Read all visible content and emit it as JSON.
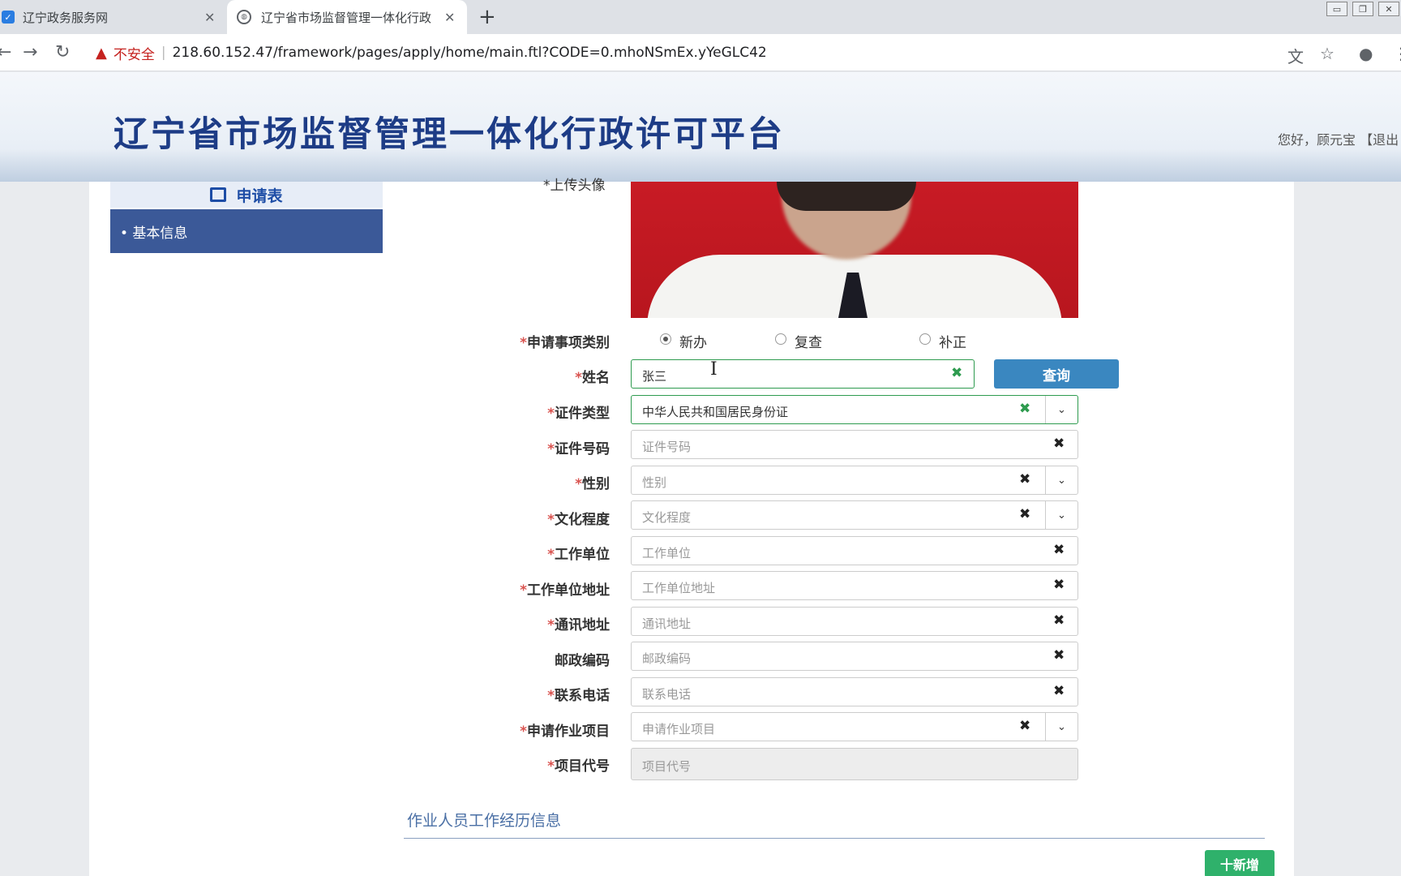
{
  "browser": {
    "tabs": [
      {
        "title": "辽宁政务服务网"
      },
      {
        "title": "辽宁省市场监督管理一体化行政许"
      }
    ],
    "new_tab": "+",
    "security_label": "不安全",
    "url": "218.60.152.47/framework/pages/apply/home/main.ftl?CODE=0.mhoNSmEx.yYeGLC42",
    "icons": [
      "back-arrow-icon",
      "forward-arrow-icon",
      "reload-icon",
      "translate-icon",
      "star-icon",
      "account-icon"
    ]
  },
  "header": {
    "title": "辽宁省市场监督管理一体化行政许可平台",
    "greeting": "您好，顾元宝 【退出"
  },
  "sidebar": {
    "heading": "申请表",
    "items": [
      {
        "label": "• 基本信息"
      }
    ]
  },
  "form": {
    "photo_label": "*上传头像",
    "application_type": {
      "label": "申请事项类别",
      "options": [
        {
          "label": "新办",
          "selected": true
        },
        {
          "label": "复查",
          "selected": false
        },
        {
          "label": "补正",
          "selected": false
        }
      ]
    },
    "fields": [
      {
        "label": "姓名",
        "required": true,
        "value": "张三",
        "placeholder": ""
      },
      {
        "label": "证件类型",
        "required": true,
        "value": "中华人民共和国居民身份证",
        "placeholder": ""
      },
      {
        "label": "证件号码",
        "required": true,
        "value": "",
        "placeholder": "证件号码"
      },
      {
        "label": "性别",
        "required": true,
        "value": "",
        "placeholder": "性别"
      },
      {
        "label": "文化程度",
        "required": true,
        "value": "",
        "placeholder": "文化程度"
      },
      {
        "label": "工作单位",
        "required": true,
        "value": "",
        "placeholder": "工作单位"
      },
      {
        "label": "工作单位地址",
        "required": true,
        "value": "",
        "placeholder": "工作单位地址"
      },
      {
        "label": "通讯地址",
        "required": true,
        "value": "",
        "placeholder": "通讯地址"
      },
      {
        "label": "邮政编码",
        "required": false,
        "value": "",
        "placeholder": "邮政编码"
      },
      {
        "label": "联系电话",
        "required": true,
        "value": "",
        "placeholder": "联系电话"
      },
      {
        "label": "申请作业项目",
        "required": true,
        "value": "",
        "placeholder": "申请作业项目"
      },
      {
        "label": "项目代号",
        "required": true,
        "value": "",
        "placeholder": "项目代号"
      }
    ],
    "query_button": "查询",
    "clear_glyph": "✖",
    "dropdown_glyph": "⌄",
    "required_mark": "*"
  },
  "work_history": {
    "title": "作业人员工作经历信息",
    "add_button": "十新增"
  },
  "colors": {
    "sidebar_active": "#3b5998",
    "title_blue": "#1d3c86",
    "query_button": "#3a87c0",
    "add_button": "#2fb16b",
    "required": "#d9534f",
    "active_field_border": "#2e9b4f"
  }
}
